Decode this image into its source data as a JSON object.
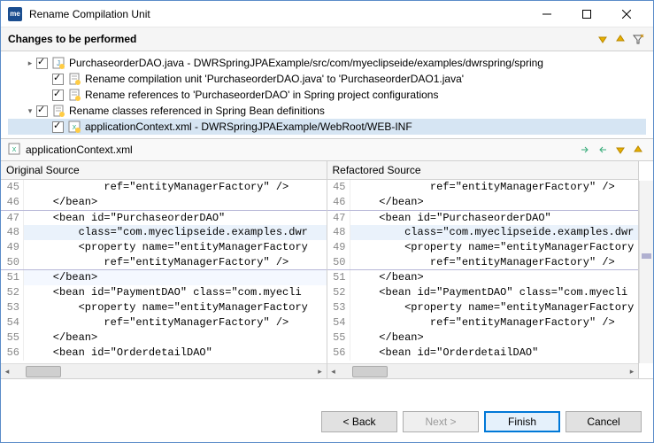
{
  "window": {
    "title": "Rename Compilation Unit",
    "app_icon_text": "me"
  },
  "changes": {
    "header": "Changes to be performed",
    "items": [
      {
        "indent": 0,
        "expander": "▸",
        "checked": true,
        "icon": "java",
        "label": "PurchaseorderDAO.java - DWRSpringJPAExample/src/com/myeclipseide/examples/dwrspring/spring"
      },
      {
        "indent": 1,
        "expander": "",
        "checked": true,
        "icon": "text",
        "label": "Rename compilation unit 'PurchaseorderDAO.java' to 'PurchaseorderDAO1.java'"
      },
      {
        "indent": 1,
        "expander": "",
        "checked": true,
        "icon": "text",
        "label": "Rename references to 'PurchaseorderDAO' in Spring project configurations"
      },
      {
        "indent": 0,
        "expander": "▾",
        "checked": true,
        "icon": "text",
        "label": "Rename classes referenced in Spring Bean definitions"
      },
      {
        "indent": 1,
        "expander": "",
        "checked": true,
        "icon": "xml",
        "label": "applicationContext.xml - DWRSpringJPAExample/WebRoot/WEB-INF",
        "selected": true
      }
    ]
  },
  "diff": {
    "file_label": "applicationContext.xml",
    "left_title": "Original Source",
    "right_title": "Refactored Source",
    "left_lines": [
      {
        "n": 45,
        "t": "            ref=\"entityManagerFactory\" />"
      },
      {
        "n": 46,
        "t": "    </bean>"
      },
      {
        "n": 47,
        "t": "    <bean id=\"PurchaseorderDAO\"",
        "cls": "hl-block-top"
      },
      {
        "n": 48,
        "t": "        class=\"com.myeclipseide.examples.dwr",
        "cls": "hl-line"
      },
      {
        "n": 49,
        "t": "        <property name=\"entityManagerFactory"
      },
      {
        "n": 50,
        "t": "            ref=\"entityManagerFactory\" />",
        "cls": "hl-block-bot"
      },
      {
        "n": 51,
        "t": "    </bean>",
        "cls": "cursor-line"
      },
      {
        "n": 52,
        "t": "    <bean id=\"PaymentDAO\" class=\"com.myecli"
      },
      {
        "n": 53,
        "t": "        <property name=\"entityManagerFactory"
      },
      {
        "n": 54,
        "t": "            ref=\"entityManagerFactory\" />"
      },
      {
        "n": 55,
        "t": "    </bean>"
      },
      {
        "n": 56,
        "t": "    <bean id=\"OrderdetailDAO\""
      }
    ],
    "right_lines": [
      {
        "n": 45,
        "t": "            ref=\"entityManagerFactory\" />"
      },
      {
        "n": 46,
        "t": "    </bean>"
      },
      {
        "n": 47,
        "t": "    <bean id=\"PurchaseorderDAO\"",
        "cls": "hl-block-top"
      },
      {
        "n": 48,
        "t": "        class=\"com.myeclipseide.examples.dwr",
        "cls": "hl-line"
      },
      {
        "n": 49,
        "t": "        <property name=\"entityManagerFactory"
      },
      {
        "n": 50,
        "t": "            ref=\"entityManagerFactory\" />",
        "cls": "hl-block-bot"
      },
      {
        "n": 51,
        "t": "    </bean>"
      },
      {
        "n": 52,
        "t": "    <bean id=\"PaymentDAO\" class=\"com.myecli"
      },
      {
        "n": 53,
        "t": "        <property name=\"entityManagerFactory"
      },
      {
        "n": 54,
        "t": "            ref=\"entityManagerFactory\" />"
      },
      {
        "n": 55,
        "t": "    </bean>"
      },
      {
        "n": 56,
        "t": "    <bean id=\"OrderdetailDAO\""
      }
    ]
  },
  "buttons": {
    "back": "< Back",
    "next": "Next >",
    "finish": "Finish",
    "cancel": "Cancel"
  }
}
